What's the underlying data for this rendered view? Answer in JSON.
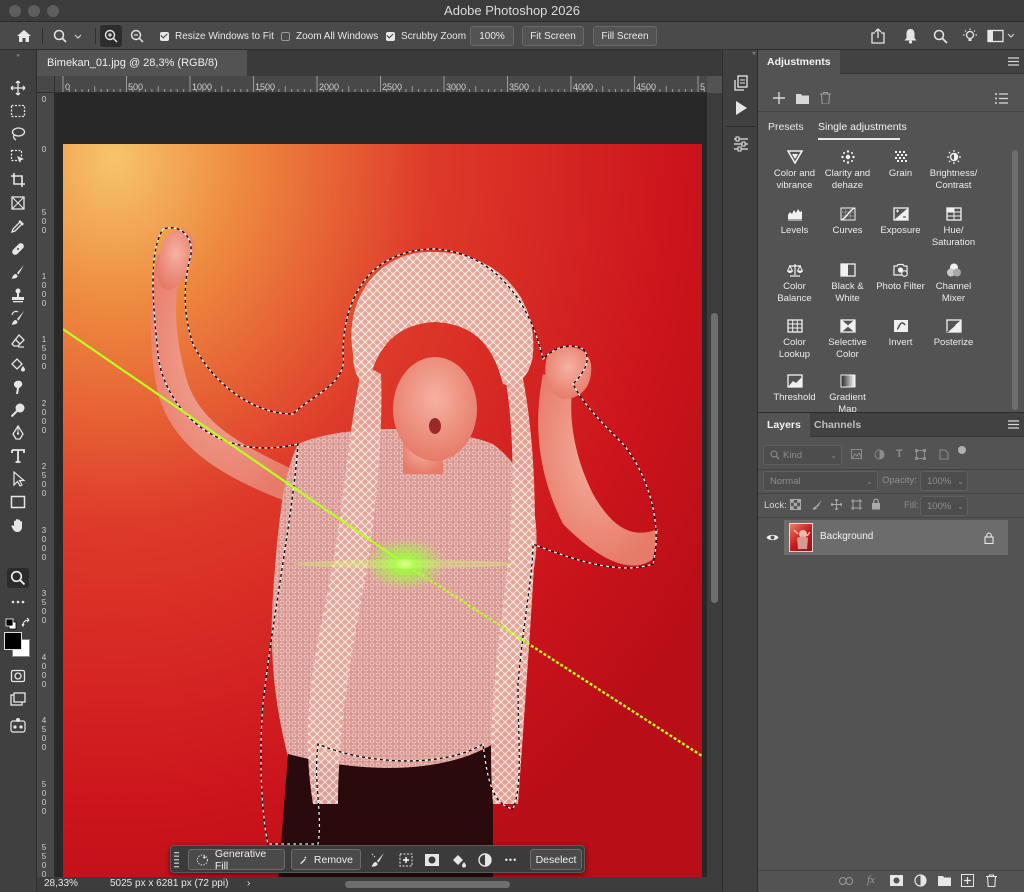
{
  "window": {
    "title": "Adobe Photoshop 2026"
  },
  "options_bar": {
    "resize_windows": {
      "label": "Resize Windows to Fit",
      "checked": true
    },
    "zoom_all": {
      "label": "Zoom All Windows",
      "checked": false
    },
    "scrubby_zoom": {
      "label": "Scrubby Zoom",
      "checked": true
    },
    "zoom_value": "100%",
    "fit_screen": "Fit Screen",
    "fill_screen": "Fill Screen"
  },
  "document": {
    "tab_title": "Bimekan_01.jpg @ 28,3% (RGB/8)",
    "ruler_h": [
      "0",
      "500",
      "1000",
      "1500",
      "2000",
      "2500",
      "3000",
      "3500",
      "4000",
      "4500",
      "5"
    ],
    "ruler_v": [
      "0",
      "0",
      "500",
      "1000",
      "1500",
      "2000",
      "2500",
      "3000",
      "3500",
      "4000",
      "4500",
      "5000",
      "5500",
      "6000"
    ],
    "status": {
      "zoom": "28,33%",
      "info": "5025 px x 6281 px (72 ppi)",
      "arrow": "›"
    }
  },
  "context_bar": {
    "generative_fill": "Generative Fill",
    "remove": "Remove",
    "more": "•••",
    "deselect": "Deselect"
  },
  "adjustments": {
    "title": "Adjustments",
    "tabs": [
      "Presets",
      "Single adjustments"
    ],
    "items": [
      {
        "label": "Color and vibrance",
        "icon": "color-vibrance-icon"
      },
      {
        "label": "Clarity and dehaze",
        "icon": "clarity-dehaze-icon"
      },
      {
        "label": "Grain",
        "icon": "grain-icon"
      },
      {
        "label": "Brightness/ Contrast",
        "icon": "brightness-contrast-icon"
      },
      {
        "label": "Levels",
        "icon": "levels-icon"
      },
      {
        "label": "Curves",
        "icon": "curves-icon"
      },
      {
        "label": "Exposure",
        "icon": "exposure-icon"
      },
      {
        "label": "Hue/ Saturation",
        "icon": "hue-saturation-icon"
      },
      {
        "label": "Color Balance",
        "icon": "color-balance-icon"
      },
      {
        "label": "Black & White",
        "icon": "black-white-icon"
      },
      {
        "label": "Photo Filter",
        "icon": "photo-filter-icon"
      },
      {
        "label": "Channel Mixer",
        "icon": "channel-mixer-icon"
      },
      {
        "label": "Color Lookup",
        "icon": "color-lookup-icon"
      },
      {
        "label": "Selective Color",
        "icon": "selective-color-icon"
      },
      {
        "label": "Invert",
        "icon": "invert-icon"
      },
      {
        "label": "Posterize",
        "icon": "posterize-icon"
      },
      {
        "label": "Threshold",
        "icon": "threshold-icon"
      },
      {
        "label": "Gradient Map",
        "icon": "gradient-map-icon"
      }
    ]
  },
  "layers": {
    "tabs": [
      "Layers",
      "Channels"
    ],
    "kind_placeholder": "Kind",
    "blend_mode": "Normal",
    "opacity_label": "Opacity:",
    "opacity_value": "100%",
    "lock_label": "Lock:",
    "fill_label": "Fill:",
    "fill_value": "100%",
    "items": [
      {
        "name": "Background",
        "visible": true,
        "locked": true
      }
    ]
  },
  "colors": {
    "accent": "#cc1b20",
    "panel": "#535353",
    "selection_line": "#b8ff1e"
  }
}
